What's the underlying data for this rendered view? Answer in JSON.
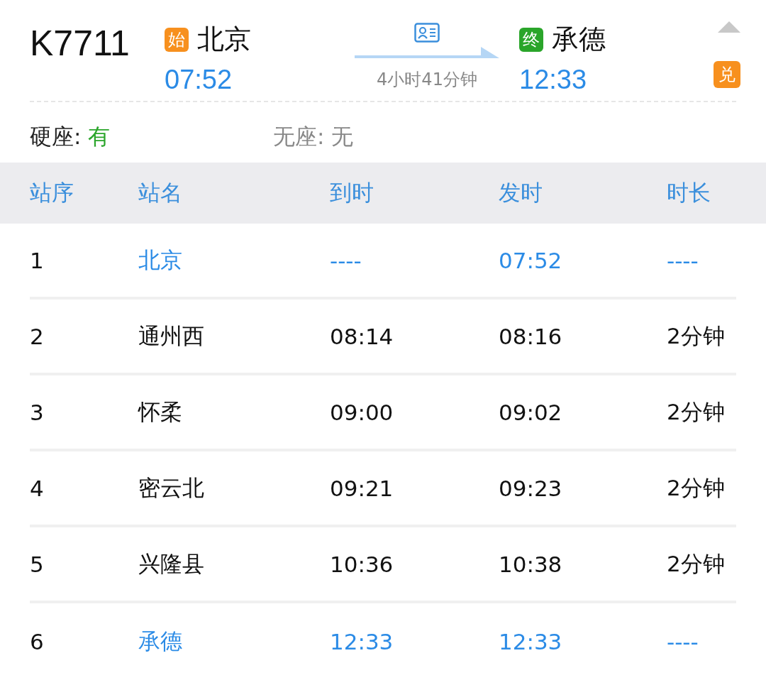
{
  "train": {
    "number": "K7711",
    "from": {
      "badge": "始",
      "station": "北京",
      "time": "07:52"
    },
    "to": {
      "badge": "终",
      "station": "承德",
      "time": "12:33"
    },
    "duration": "4小时41分钟",
    "exchange_badge": "兑"
  },
  "seats": [
    {
      "label": "硬座:",
      "value": "有",
      "available": true
    },
    {
      "label": "无座:",
      "value": "无",
      "available": false
    }
  ],
  "table": {
    "columns": [
      "站序",
      "站名",
      "到时",
      "发时",
      "时长"
    ],
    "rows": [
      {
        "kind": "terminal",
        "cells": [
          "1",
          "北京",
          "----",
          "07:52",
          "----"
        ]
      },
      {
        "kind": "stop",
        "cells": [
          "2",
          "通州西",
          "08:14",
          "08:16",
          "2分钟"
        ]
      },
      {
        "kind": "stop",
        "cells": [
          "3",
          "怀柔",
          "09:00",
          "09:02",
          "2分钟"
        ]
      },
      {
        "kind": "stop",
        "cells": [
          "4",
          "密云北",
          "09:21",
          "09:23",
          "2分钟"
        ]
      },
      {
        "kind": "stop",
        "cells": [
          "5",
          "兴隆县",
          "10:36",
          "10:38",
          "2分钟"
        ]
      },
      {
        "kind": "terminal",
        "cells": [
          "6",
          "承德",
          "12:33",
          "12:33",
          "----"
        ]
      }
    ]
  }
}
